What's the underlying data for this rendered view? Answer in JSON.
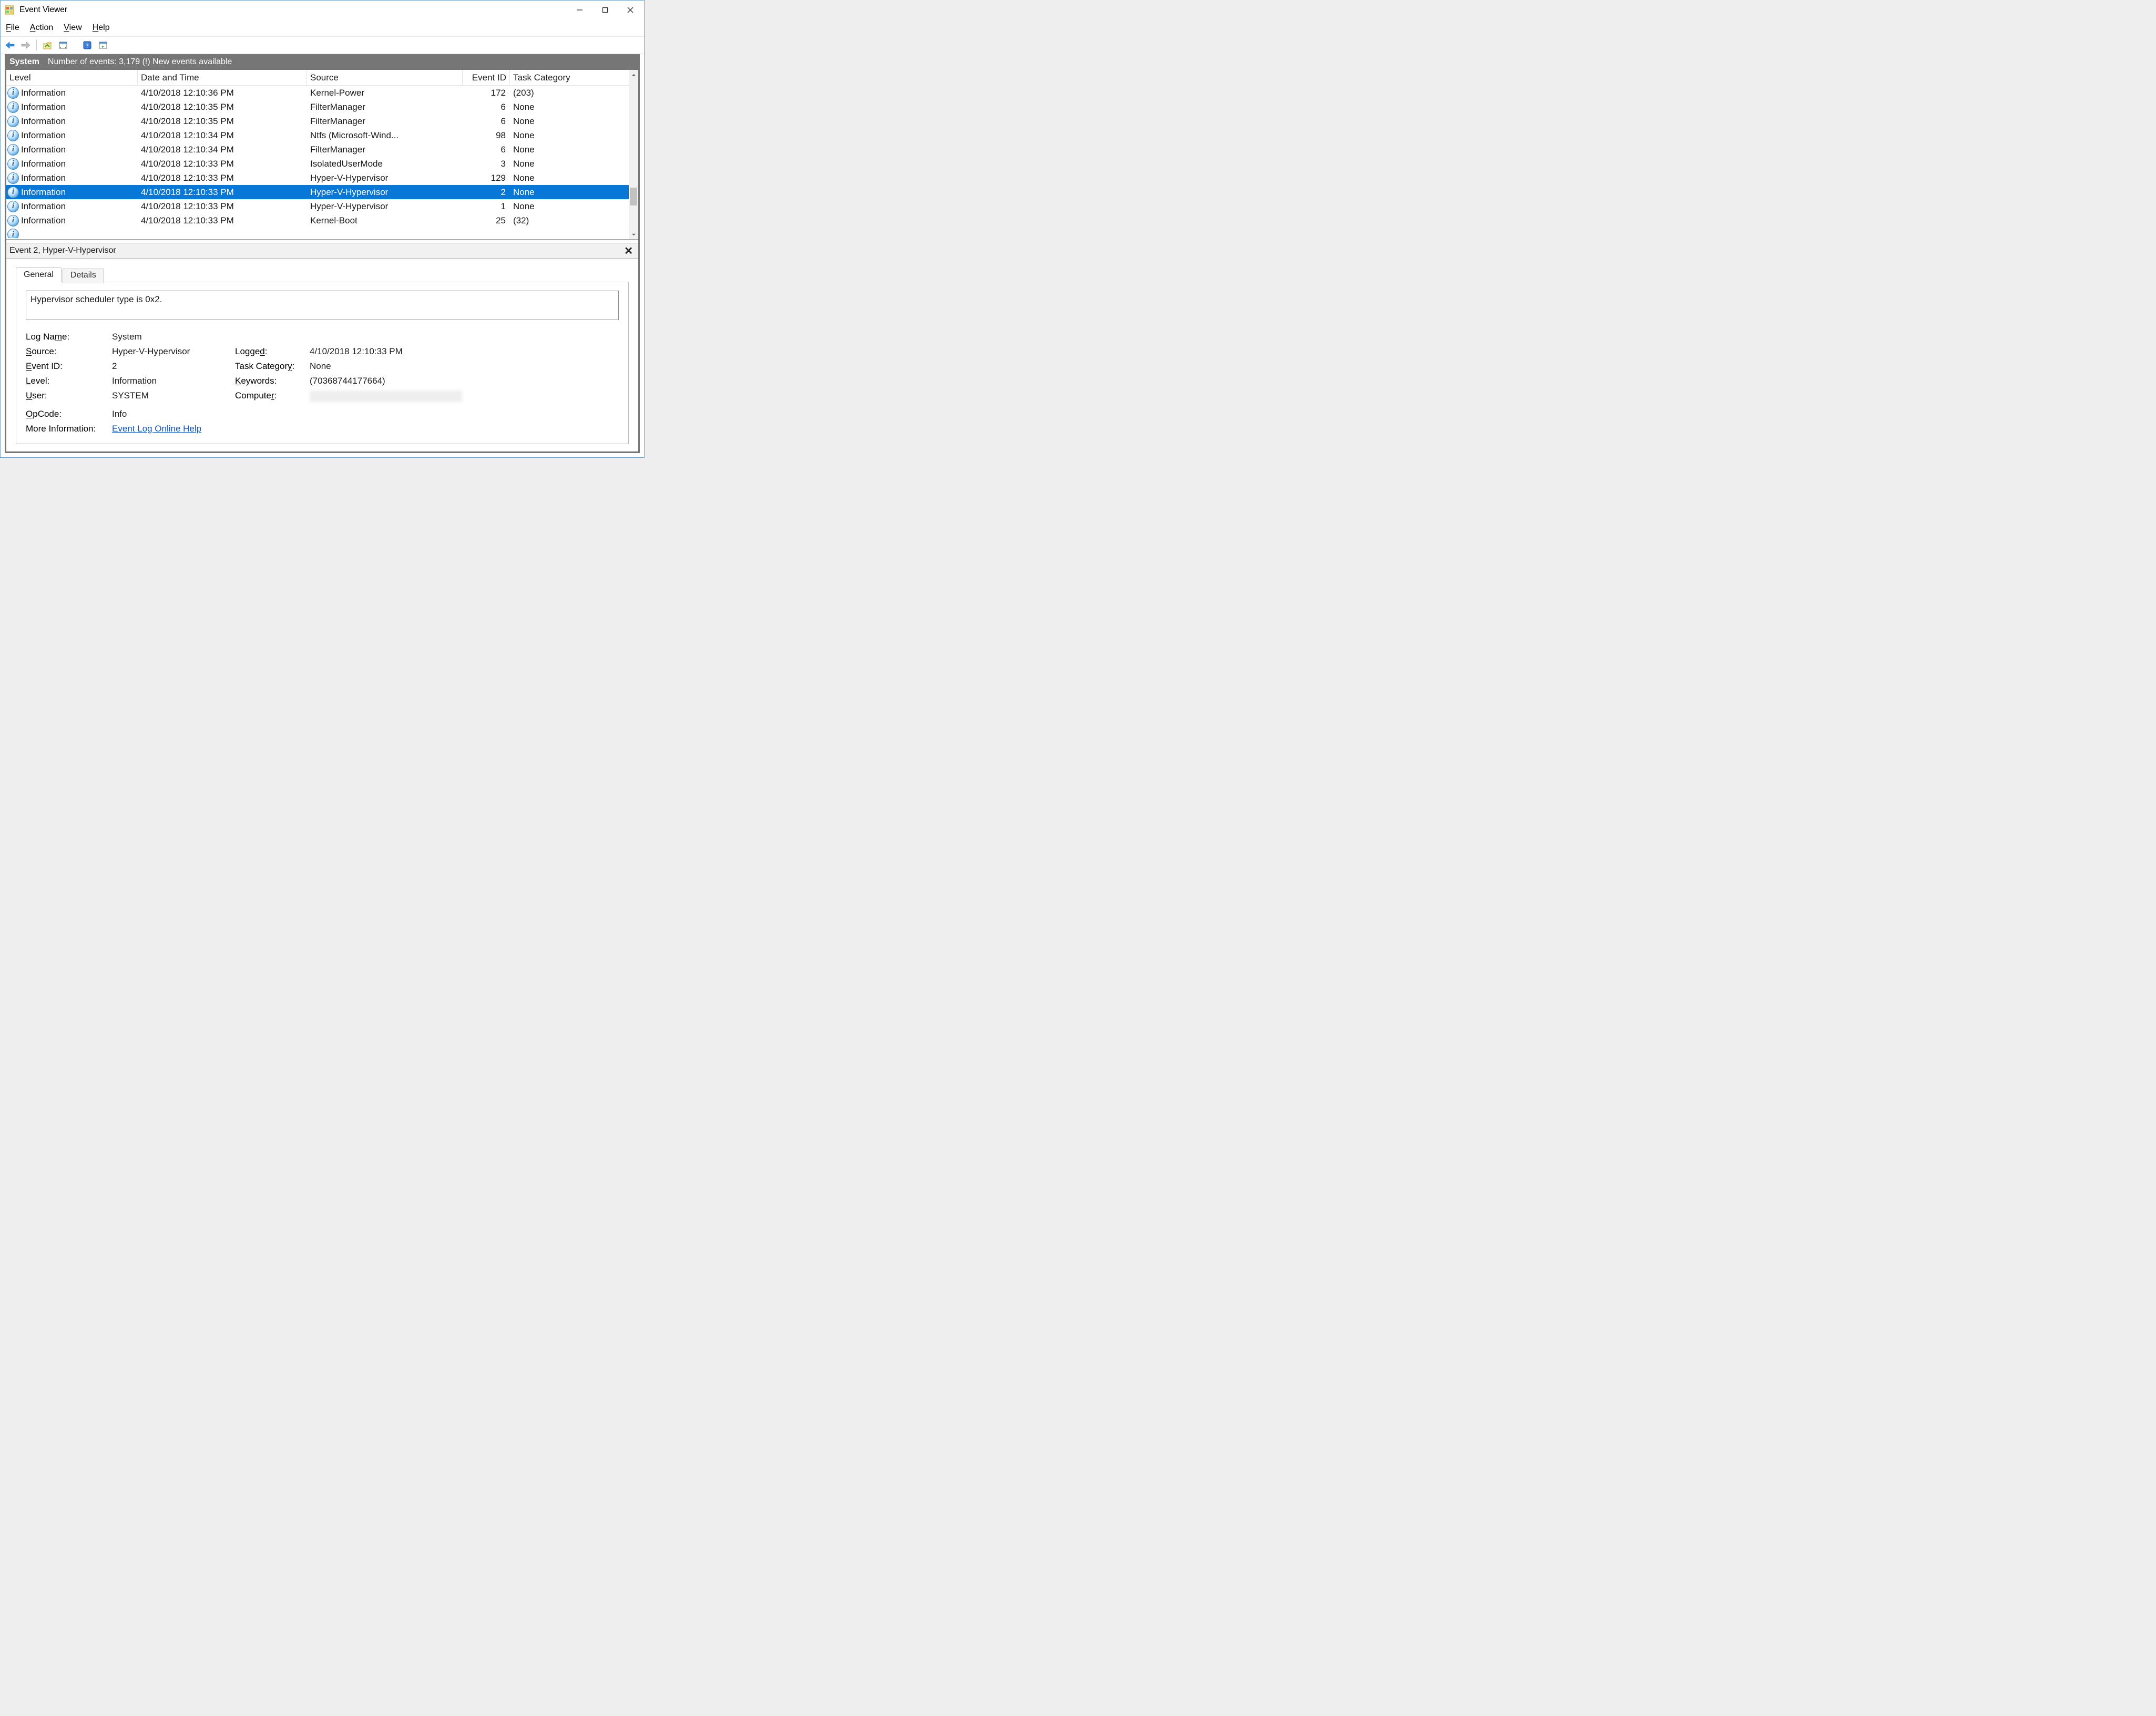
{
  "window": {
    "title": "Event Viewer"
  },
  "menu": {
    "file": "File",
    "action": "Action",
    "view": "View",
    "help": "Help"
  },
  "panel": {
    "log_name": "System",
    "status": "Number of events: 3,179 (!) New events available"
  },
  "grid": {
    "columns": {
      "level": "Level",
      "datetime": "Date and Time",
      "source": "Source",
      "event_id": "Event ID",
      "task_category": "Task Category"
    },
    "rows": [
      {
        "level": "Information",
        "datetime": "4/10/2018 12:10:36 PM",
        "source": "Kernel-Power",
        "event_id": "172",
        "task_category": "(203)",
        "selected": false
      },
      {
        "level": "Information",
        "datetime": "4/10/2018 12:10:35 PM",
        "source": "FilterManager",
        "event_id": "6",
        "task_category": "None",
        "selected": false
      },
      {
        "level": "Information",
        "datetime": "4/10/2018 12:10:35 PM",
        "source": "FilterManager",
        "event_id": "6",
        "task_category": "None",
        "selected": false
      },
      {
        "level": "Information",
        "datetime": "4/10/2018 12:10:34 PM",
        "source": "Ntfs (Microsoft-Wind...",
        "event_id": "98",
        "task_category": "None",
        "selected": false
      },
      {
        "level": "Information",
        "datetime": "4/10/2018 12:10:34 PM",
        "source": "FilterManager",
        "event_id": "6",
        "task_category": "None",
        "selected": false
      },
      {
        "level": "Information",
        "datetime": "4/10/2018 12:10:33 PM",
        "source": "IsolatedUserMode",
        "event_id": "3",
        "task_category": "None",
        "selected": false
      },
      {
        "level": "Information",
        "datetime": "4/10/2018 12:10:33 PM",
        "source": "Hyper-V-Hypervisor",
        "event_id": "129",
        "task_category": "None",
        "selected": false
      },
      {
        "level": "Information",
        "datetime": "4/10/2018 12:10:33 PM",
        "source": "Hyper-V-Hypervisor",
        "event_id": "2",
        "task_category": "None",
        "selected": true
      },
      {
        "level": "Information",
        "datetime": "4/10/2018 12:10:33 PM",
        "source": "Hyper-V-Hypervisor",
        "event_id": "1",
        "task_category": "None",
        "selected": false
      },
      {
        "level": "Information",
        "datetime": "4/10/2018 12:10:33 PM",
        "source": "Kernel-Boot",
        "event_id": "25",
        "task_category": "(32)",
        "selected": false
      }
    ]
  },
  "detail": {
    "title": "Event 2, Hyper-V-Hypervisor",
    "tabs": {
      "general": "General",
      "details": "Details"
    },
    "message": "Hypervisor scheduler type is 0x2.",
    "props": {
      "log_name_label": "Log Name:",
      "log_name_value": "System",
      "source_label": "Source:",
      "source_value": "Hyper-V-Hypervisor",
      "logged_label": "Logged:",
      "logged_value": "4/10/2018 12:10:33 PM",
      "event_id_label": "Event ID:",
      "event_id_value": "2",
      "task_category_label": "Task Category:",
      "task_category_value": "None",
      "level_label": "Level:",
      "level_value": "Information",
      "keywords_label": "Keywords:",
      "keywords_value": "(70368744177664)",
      "user_label": "User:",
      "user_value": "SYSTEM",
      "computer_label": "Computer:",
      "opcode_label": "OpCode:",
      "opcode_value": "Info",
      "more_info_label": "More Information:",
      "more_info_link": "Event Log Online Help"
    }
  }
}
